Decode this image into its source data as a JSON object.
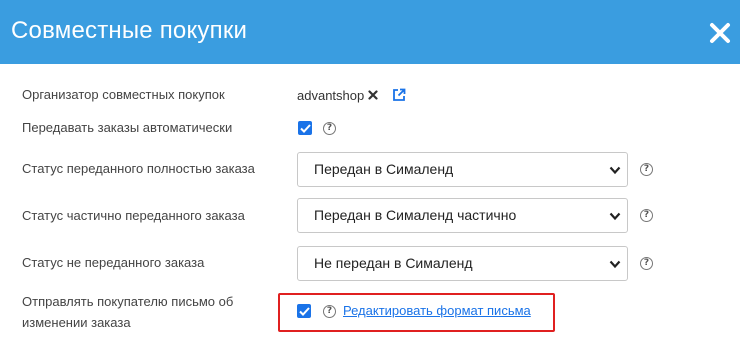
{
  "dialog": {
    "title": "Совместные покупки"
  },
  "fields": {
    "organizer": {
      "label": "Организатор совместных покупок",
      "value": "advantshop"
    },
    "auto_transfer": {
      "label": "Передавать заказы автоматически",
      "checked": true
    },
    "status_full": {
      "label": "Статус переданного полностью заказа",
      "selected": "Передан в Сималенд"
    },
    "status_partial": {
      "label": "Статус частично переданного заказа",
      "selected": "Передан в Сималенд частично"
    },
    "status_not": {
      "label": "Статус не переданного заказа",
      "selected": "Не передан в Сималенд"
    },
    "notify_buyer": {
      "label_line1": "Отправлять покупателю письмо об",
      "label_line2": "изменении заказа",
      "checked": true,
      "edit_link": "Редактировать формат письма"
    }
  },
  "colors": {
    "header_bg": "#3a9de0",
    "accent": "#1a73e8",
    "highlight_border": "#e02020"
  },
  "icons": {
    "close": "close-icon",
    "remove": "remove-x-icon",
    "external_link": "external-link-icon",
    "help": "question-circle-icon",
    "chevron": "chevron-down-icon",
    "check": "checkmark-icon"
  }
}
